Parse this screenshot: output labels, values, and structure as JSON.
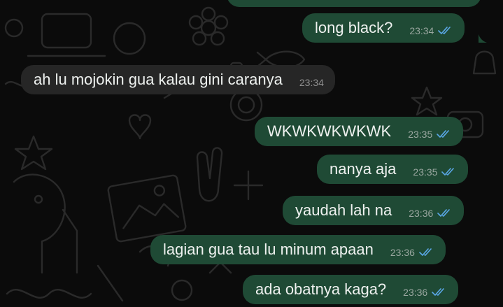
{
  "colors": {
    "background": "#0b0b0b",
    "outgoing_bubble": "#1f4a35",
    "incoming_bubble": "#262626",
    "text": "#eef1ef",
    "timestamp": "#9aa7a0",
    "read_check": "#5aa7e6"
  },
  "messages": [
    {
      "direction": "outgoing",
      "text": "long black?",
      "time": "23:34",
      "status_icon": "double-check-read-icon"
    },
    {
      "direction": "incoming",
      "text": "ah lu mojokin gua kalau gini caranya",
      "time": "23:34"
    },
    {
      "direction": "outgoing",
      "text": "WKWKWKWKWK",
      "time": "23:35",
      "status_icon": "double-check-read-icon"
    },
    {
      "direction": "outgoing",
      "text": "nanya aja",
      "time": "23:35",
      "status_icon": "double-check-read-icon"
    },
    {
      "direction": "outgoing",
      "text": "yaudah lah na",
      "time": "23:36",
      "status_icon": "double-check-read-icon"
    },
    {
      "direction": "outgoing",
      "text": "lagian gua tau lu minum apaan",
      "time": "23:36",
      "status_icon": "double-check-read-icon"
    },
    {
      "direction": "outgoing",
      "text": "ada obatnya kaga?",
      "time": "23:36",
      "status_icon": "double-check-read-icon"
    }
  ]
}
